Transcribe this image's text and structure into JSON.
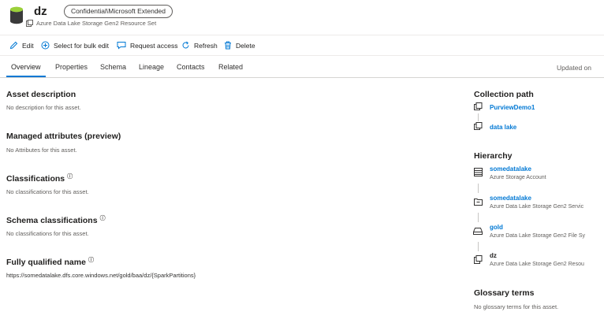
{
  "header": {
    "title": "dz",
    "badge": "Confidential\\Microsoft Extended",
    "subtitle": "Azure Data Lake Storage Gen2 Resource Set"
  },
  "toolbar": {
    "edit": "Edit",
    "bulk_edit": "Select for bulk edit",
    "request_access": "Request access",
    "refresh": "Refresh",
    "delete": "Delete"
  },
  "tabs": [
    {
      "label": "Overview"
    },
    {
      "label": "Properties"
    },
    {
      "label": "Schema"
    },
    {
      "label": "Lineage"
    },
    {
      "label": "Contacts"
    },
    {
      "label": "Related"
    }
  ],
  "updated_on": "Updated on",
  "main": {
    "asset_description": {
      "title": "Asset description",
      "text": "No description for this asset."
    },
    "managed_attributes": {
      "title": "Managed attributes (preview)",
      "text": "No Attributes for this asset."
    },
    "classifications": {
      "title": "Classifications",
      "text": "No classifications for this asset."
    },
    "schema_classifications": {
      "title": "Schema classifications",
      "text": "No classifications for this asset."
    },
    "fqn": {
      "title": "Fully qualified name",
      "text": "https://somedatalake.dfs.core.windows.net/gold/baa/dz/{SparkPartitions}"
    }
  },
  "side": {
    "collection_path": {
      "title": "Collection path",
      "items": [
        {
          "label": "PurviewDemo1"
        },
        {
          "label": "data lake"
        }
      ]
    },
    "hierarchy": {
      "title": "Hierarchy",
      "items": [
        {
          "label": "somedatalake",
          "type": "Azure Storage Account"
        },
        {
          "label": "somedatalake",
          "type": "Azure Data Lake Storage Gen2 Servic"
        },
        {
          "label": "gold",
          "type": "Azure Data Lake Storage Gen2 File Sy"
        },
        {
          "label": "dz",
          "type": "Azure Data Lake Storage Gen2 Resou"
        }
      ]
    },
    "glossary": {
      "title": "Glossary terms",
      "text": "No glossary terms for this asset."
    }
  },
  "colors": {
    "accent": "#0078d4",
    "text": "#323130",
    "muted": "#605e5c"
  }
}
